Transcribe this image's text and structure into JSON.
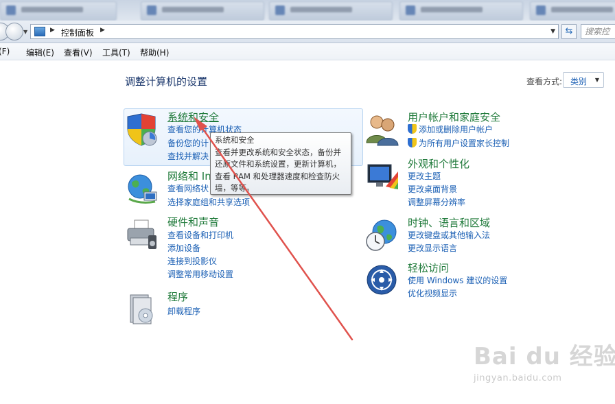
{
  "address_bar": {
    "breadcrumb": "控制面板",
    "search_placeholder": "搜索控"
  },
  "menu": {
    "file": "(F)",
    "edit": "编辑(E)",
    "view": "查看(V)",
    "tools": "工具(T)",
    "help": "帮助(H)"
  },
  "header": {
    "title": "调整计算机的设置",
    "view_by_label": "查看方式:",
    "view_by_value": "类别"
  },
  "categories": {
    "system_security": {
      "title": "系统和安全",
      "links": [
        "查看您的计算机状态",
        "备份您的计",
        "查找并解决"
      ]
    },
    "network": {
      "title": "网络和 In",
      "links": [
        "查看网络状",
        "选择家庭组和共享选项"
      ]
    },
    "hardware": {
      "title": "硬件和声音",
      "links": [
        "查看设备和打印机",
        "添加设备",
        "连接到投影仪",
        "调整常用移动设置"
      ]
    },
    "programs": {
      "title": "程序",
      "links": [
        "卸载程序"
      ]
    },
    "user_accounts": {
      "title": "用户帐户和家庭安全",
      "links": [
        "添加或删除用户帐户",
        "为所有用户设置家长控制"
      ]
    },
    "appearance": {
      "title": "外观和个性化",
      "links": [
        "更改主题",
        "更改桌面背景",
        "调整屏幕分辨率"
      ]
    },
    "clock": {
      "title": "时钟、语言和区域",
      "links": [
        "更改键盘或其他输入法",
        "更改显示语言"
      ]
    },
    "ease": {
      "title": "轻松访问",
      "links": [
        "使用 Windows 建议的设置",
        "优化视频显示"
      ]
    }
  },
  "tooltip": {
    "title": "系统和安全",
    "body": "查看并更改系统和安全状态，备份并还原文件和系统设置，更新计算机，查看 RAM 和处理器速度和检查防火墙，等等。"
  },
  "watermark": {
    "brand": "Bai du 经验",
    "url": "jingyan.baidu.com"
  },
  "colors": {
    "category_title": "#1f7a3a",
    "link": "#1a5fb4",
    "annotation_arrow": "#e0524d"
  }
}
